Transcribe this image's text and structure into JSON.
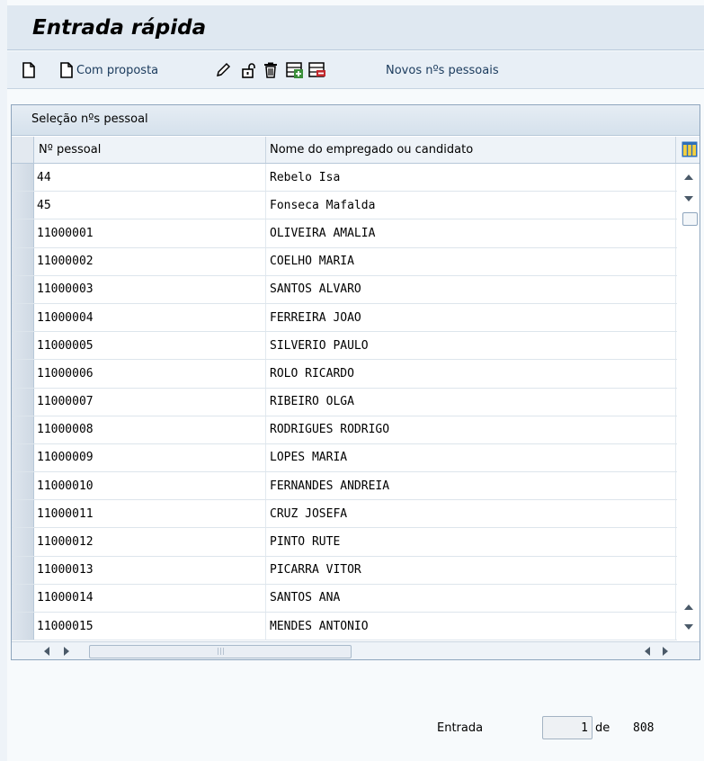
{
  "title": "Entrada rápida",
  "toolbar": {
    "new_icon": "document-blank-icon",
    "with_proposal_label": "Com proposta",
    "edit_icon": "pencil-icon",
    "unlock_icon": "lock-open-icon",
    "delete_icon": "trash-icon",
    "add_icon": "add-rows-icon",
    "remove_icon": "remove-rows-icon",
    "new_numbers_label": "Novos nºs pessoais"
  },
  "table": {
    "title": "Seleção nºs pessoal",
    "columns": [
      "Nº pessoal",
      "Nome do empregado ou candidato"
    ],
    "rows": [
      {
        "id": "44",
        "name": "Rebelo Isa"
      },
      {
        "id": "45",
        "name": "Fonseca Mafalda"
      },
      {
        "id": "11000001",
        "name": "OLIVEIRA AMALIA"
      },
      {
        "id": "11000002",
        "name": "COELHO MARIA"
      },
      {
        "id": "11000003",
        "name": "SANTOS ALVARO"
      },
      {
        "id": "11000004",
        "name": "FERREIRA JOAO"
      },
      {
        "id": "11000005",
        "name": "SILVERIO PAULO"
      },
      {
        "id": "11000006",
        "name": "ROLO RICARDO"
      },
      {
        "id": "11000007",
        "name": "RIBEIRO OLGA"
      },
      {
        "id": "11000008",
        "name": "RODRIGUES RODRIGO"
      },
      {
        "id": "11000009",
        "name": "LOPES MARIA"
      },
      {
        "id": "11000010",
        "name": "FERNANDES ANDREIA"
      },
      {
        "id": "11000011",
        "name": "CRUZ JOSEFA"
      },
      {
        "id": "11000012",
        "name": "PINTO RUTE"
      },
      {
        "id": "11000013",
        "name": "PICARRA VITOR"
      },
      {
        "id": "11000014",
        "name": "SANTOS ANA"
      },
      {
        "id": "11000015",
        "name": "MENDES ANTONIO"
      }
    ]
  },
  "footer": {
    "entry_label": "Entrada",
    "entry_value": "1",
    "of_label": "de",
    "total": "808"
  },
  "colors": {
    "title_bg": "#dfe8f1",
    "toolbar_bg": "#e8eff6",
    "link_text": "#1a3a5c",
    "frame_border": "#8ea5bd",
    "new_row_green": "#3a8f3a",
    "delete_row_red": "#c0282d"
  }
}
